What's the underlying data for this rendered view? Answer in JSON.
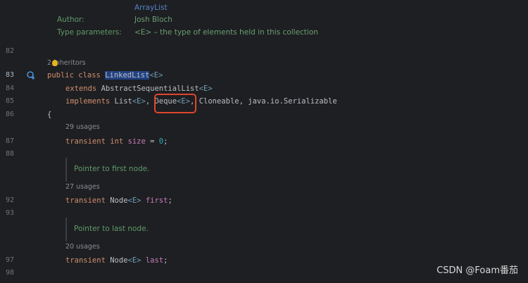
{
  "javadoc": {
    "top_partial": "",
    "arraylist": "ArrayList",
    "author_label": "Author:",
    "author_value": "Josh Bloch",
    "type_params_label": "Type parameters:",
    "type_params_value": "<E> – the type of elements held in this collection"
  },
  "line_numbers": {
    "n82": "82",
    "n83": "83",
    "n84": "84",
    "n85": "85",
    "n86": "86",
    "n87": "87",
    "n88": "88",
    "n92": "92",
    "n93": "93",
    "n97": "97",
    "n98": "98"
  },
  "hints": {
    "inheritors": "2 inheritors",
    "usages_size": "29 usages",
    "usages_first": "27 usages",
    "usages_last": "20 usages"
  },
  "code": {
    "public": "public",
    "class": "class",
    "classname": "LinkedList",
    "generic_e": "<E>",
    "extends": "extends",
    "abstract_list": "AbstractSequentialList",
    "implements": "implements",
    "list": "List",
    "comma": ", ",
    "deque": "Deque",
    "cloneable": "Cloneable",
    "serializable": "java.io.Serializable",
    "open_brace": "{",
    "transient": "transient",
    "int": "int",
    "size": "size",
    "eq_zero": " = ",
    "zero": "0",
    "semicolon": ";",
    "node": "Node",
    "first": "first",
    "last": "last"
  },
  "docs": {
    "first_node": "Pointer to first node.",
    "last_node": "Pointer to last node."
  },
  "watermark": "CSDN @Foam番茄"
}
